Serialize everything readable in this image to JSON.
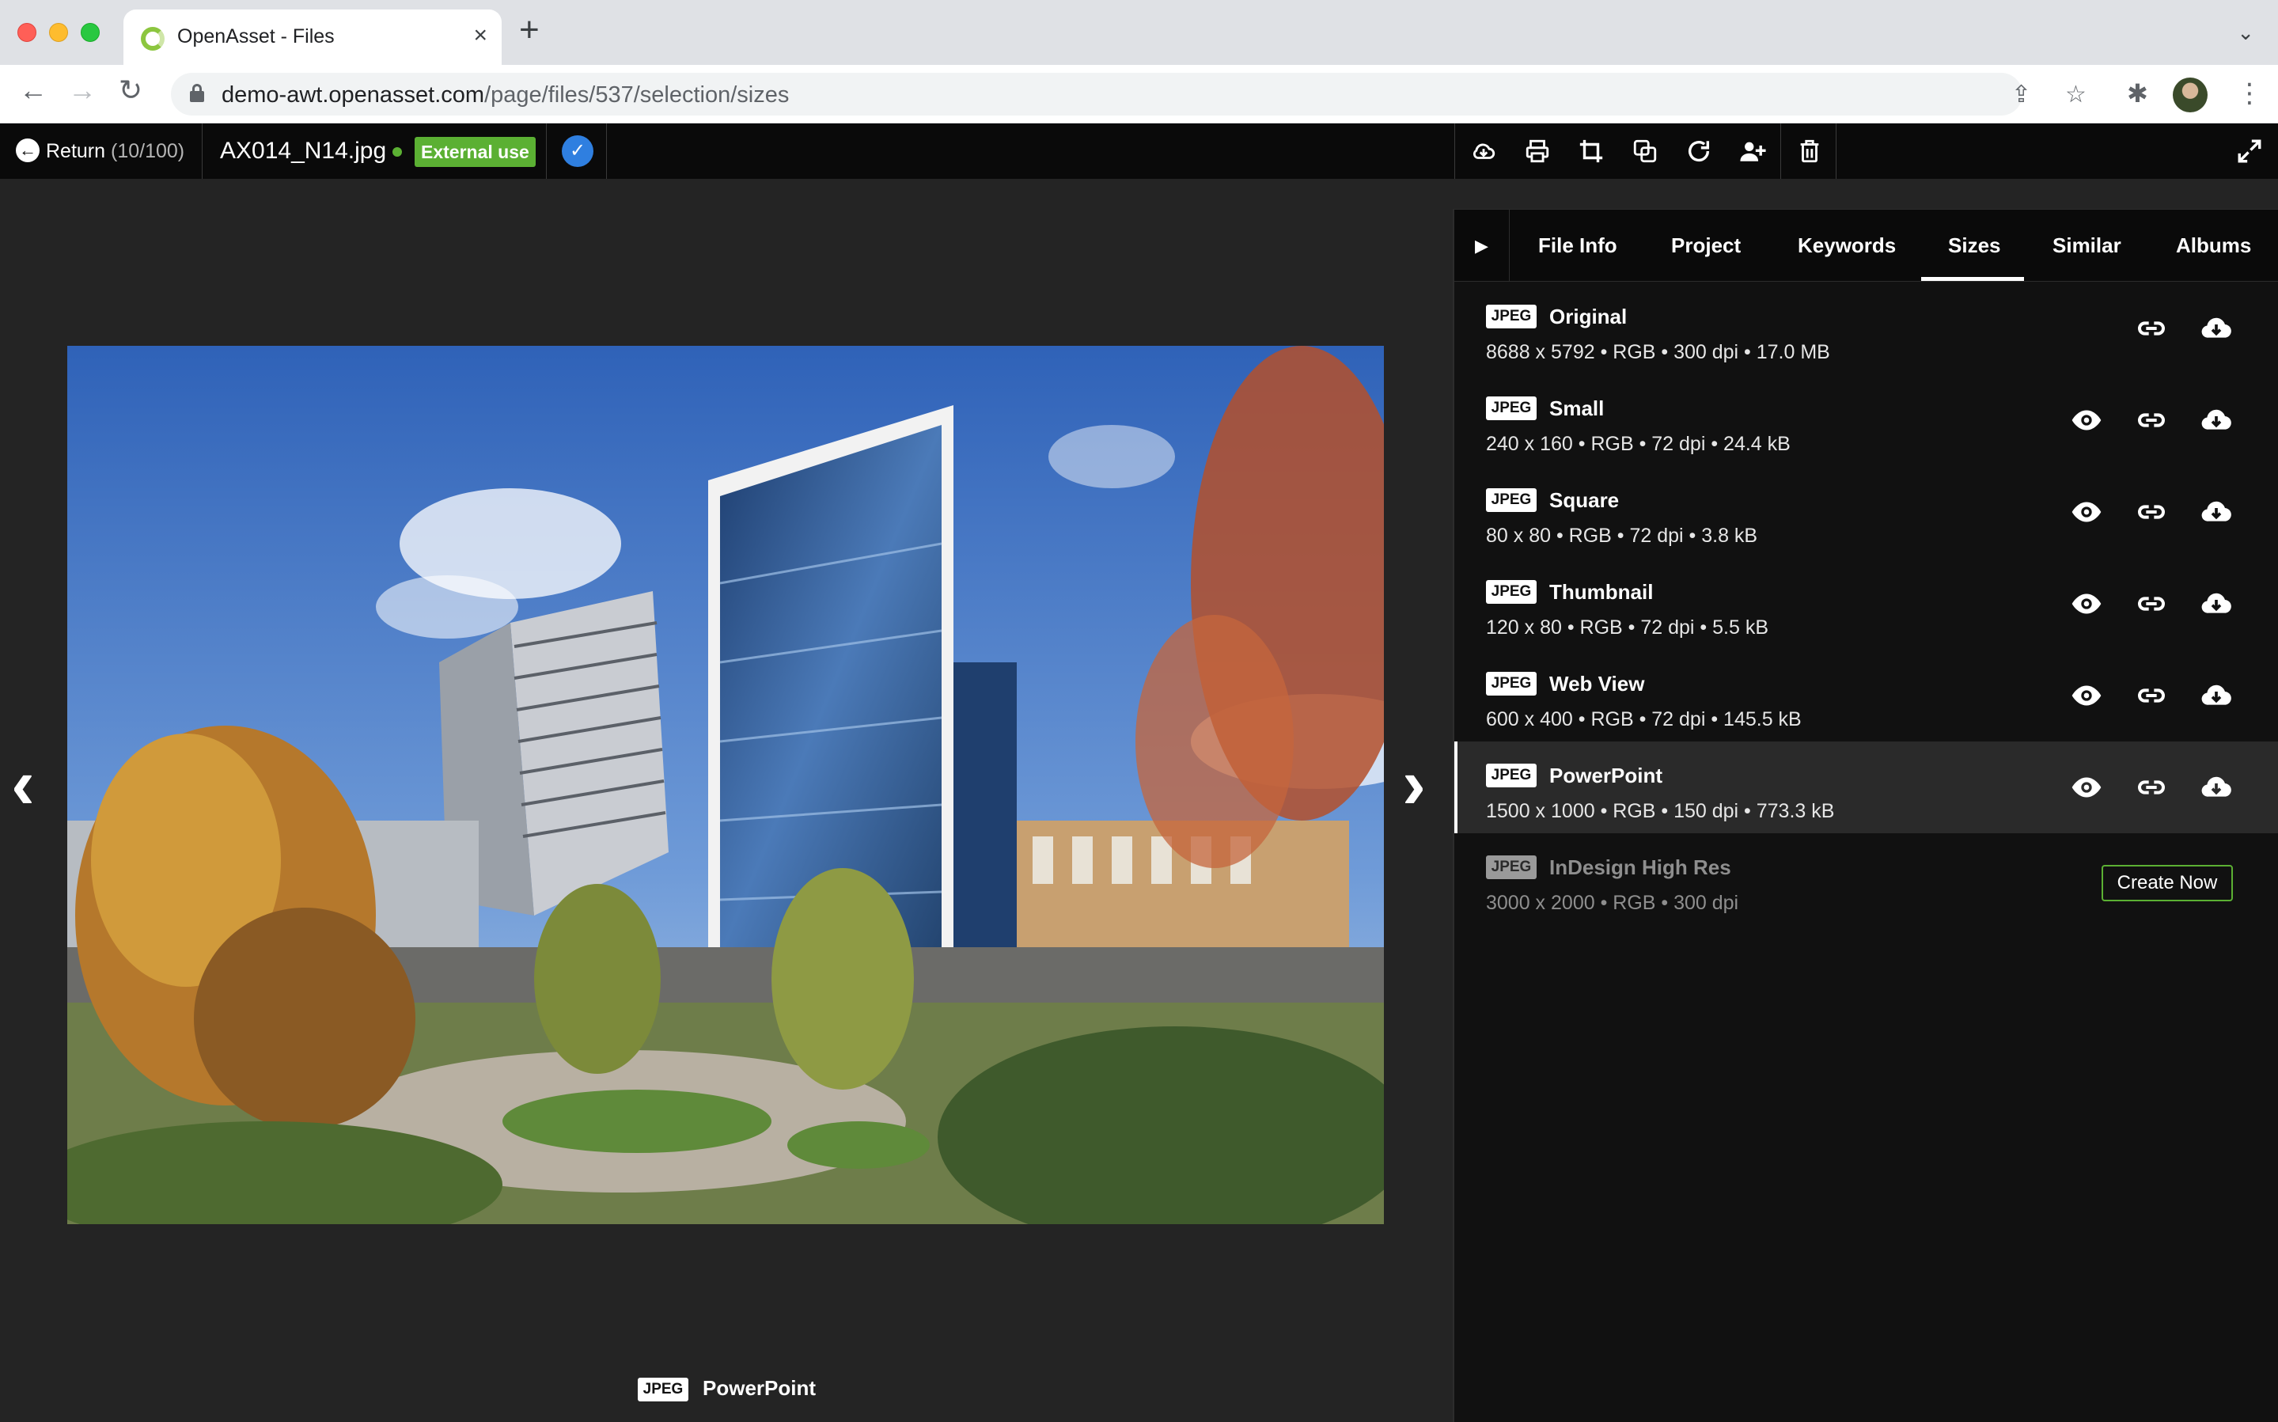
{
  "browser": {
    "tab_title": "OpenAsset - Files",
    "tab_close": "×",
    "new_tab": "+",
    "url_host": "demo-awt.openasset.com",
    "url_path": "/page/files/537/selection/sizes"
  },
  "app": {
    "return_label": "Return",
    "return_count": "(10/100)",
    "filename": "AX014_N14.jpg",
    "usage_badge": "External use",
    "colors": {
      "accent_green": "#5bb033",
      "accent_blue": "#2f7fe0",
      "background": "#242424"
    },
    "actions": [
      "cloud-download-icon",
      "print-icon",
      "crop-icon",
      "copy-icon",
      "rotate-icon",
      "add-user-icon",
      "trash-icon"
    ]
  },
  "viewer": {
    "caption_format": "JPEG",
    "caption_name": "PowerPoint",
    "prev_arrow": "‹",
    "next_arrow": "›"
  },
  "panel": {
    "toggle": "▶",
    "tabs": [
      "File Info",
      "Project",
      "Keywords",
      "Sizes",
      "Similar",
      "Albums"
    ],
    "active_tab": "Sizes",
    "sizes": [
      {
        "format": "JPEG",
        "name": "Original",
        "meta": "8688 x 5792 • RGB • 300 dpi • 17.0 MB"
      },
      {
        "format": "JPEG",
        "name": "Small",
        "meta": "240 x 160 • RGB • 72 dpi • 24.4 kB"
      },
      {
        "format": "JPEG",
        "name": "Square",
        "meta": "80 x 80 • RGB • 72 dpi • 3.8 kB"
      },
      {
        "format": "JPEG",
        "name": "Thumbnail",
        "meta": "120 x 80 • RGB • 72 dpi • 5.5 kB"
      },
      {
        "format": "JPEG",
        "name": "Web View",
        "meta": "600 x 400 • RGB • 72 dpi • 145.5 kB"
      },
      {
        "format": "JPEG",
        "name": "PowerPoint",
        "meta": "1500 x 1000 • RGB • 150 dpi • 773.3 kB"
      },
      {
        "format": "JPEG",
        "name": "InDesign High Res",
        "meta": "3000 x 2000 • RGB • 300 dpi",
        "action": "Create Now"
      }
    ]
  }
}
